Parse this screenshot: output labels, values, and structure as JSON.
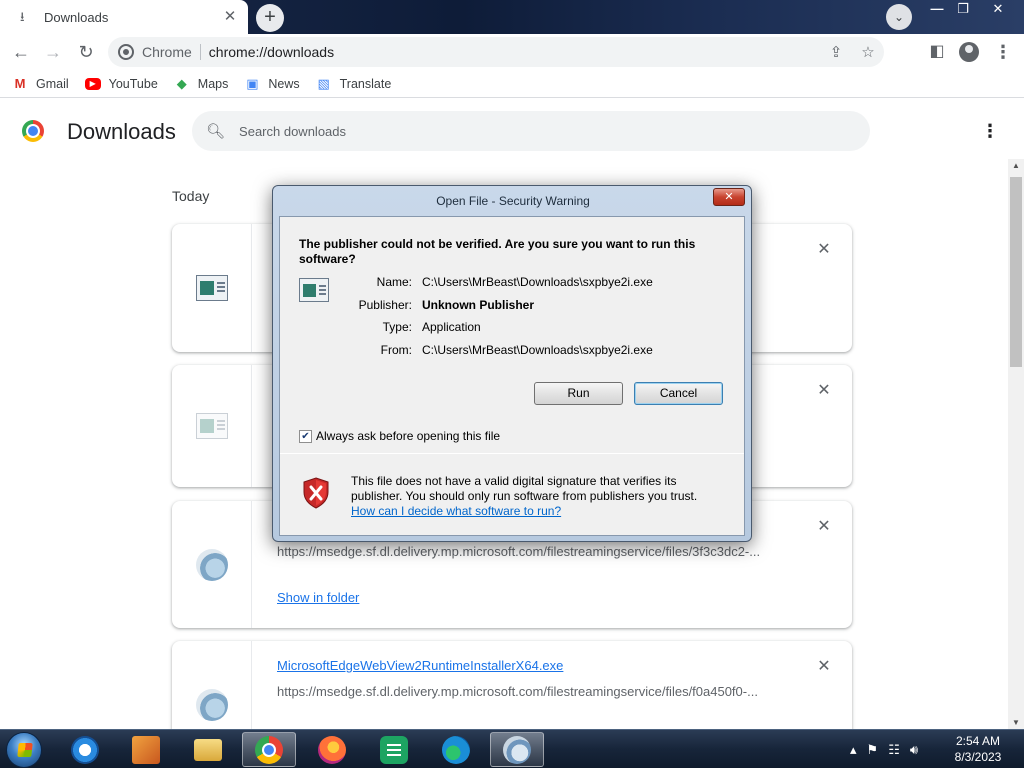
{
  "tabs": [
    {
      "title": "Downloads",
      "icon": "download-icon"
    }
  ],
  "toolbar": {
    "origin": "Chrome",
    "url": "chrome://downloads"
  },
  "bookmarks": [
    {
      "label": "Gmail",
      "icon": "gmail-icon"
    },
    {
      "label": "YouTube",
      "icon": "youtube-icon"
    },
    {
      "label": "Maps",
      "icon": "maps-icon"
    },
    {
      "label": "News",
      "icon": "news-icon"
    },
    {
      "label": "Translate",
      "icon": "translate-icon"
    }
  ],
  "downloads_page": {
    "title": "Downloads",
    "search_placeholder": "Search downloads",
    "section_date": "Today",
    "items": [
      {
        "icon": "application-file-icon"
      },
      {
        "icon": "application-file-icon"
      },
      {
        "icon": "setup-file-icon",
        "url": "https://msedge.sf.dl.delivery.mp.microsoft.com/filestreamingservice/files/3f3c3dc2-...",
        "action": "Show in folder"
      },
      {
        "icon": "setup-file-icon",
        "name": "MicrosoftEdgeWebView2RuntimeInstallerX64.exe",
        "url": "https://msedge.sf.dl.delivery.mp.microsoft.com/filestreamingservice/files/f0a450f0-..."
      }
    ]
  },
  "dialog": {
    "title": "Open File - Security Warning",
    "question": "The publisher could not be verified.  Are you sure you want to run this software?",
    "fields": [
      {
        "label": "Name:",
        "value": "C:\\Users\\MrBeast\\Downloads\\sxpbye2i.exe",
        "bold": false
      },
      {
        "label": "Publisher:",
        "value": "Unknown Publisher",
        "bold": true
      },
      {
        "label": "Type:",
        "value": "Application",
        "bold": false
      },
      {
        "label": "From:",
        "value": "C:\\Users\\MrBeast\\Downloads\\sxpbye2i.exe",
        "bold": false
      }
    ],
    "run_label": "Run",
    "cancel_label": "Cancel",
    "checkbox_label": "Always ask before opening this file",
    "checkbox_checked": true,
    "warning_text": "This file does not have a valid digital signature that verifies its publisher.  You should only run software from publishers you trust.",
    "help_link": "How can I decide what software to run?"
  },
  "taskbar": {
    "apps": [
      "internet-explorer-icon",
      "media-center-icon",
      "file-explorer-icon",
      "chrome-icon",
      "firefox-icon",
      "sheets-icon",
      "edge-icon",
      "setup-icon"
    ],
    "active": [
      "chrome-icon",
      "setup-icon"
    ],
    "time": "2:54 AM",
    "date": "8/3/2023"
  },
  "colors": {
    "link": "#1a73e8",
    "dialog_link": "#0066cc",
    "close_red": "#c8432f"
  }
}
